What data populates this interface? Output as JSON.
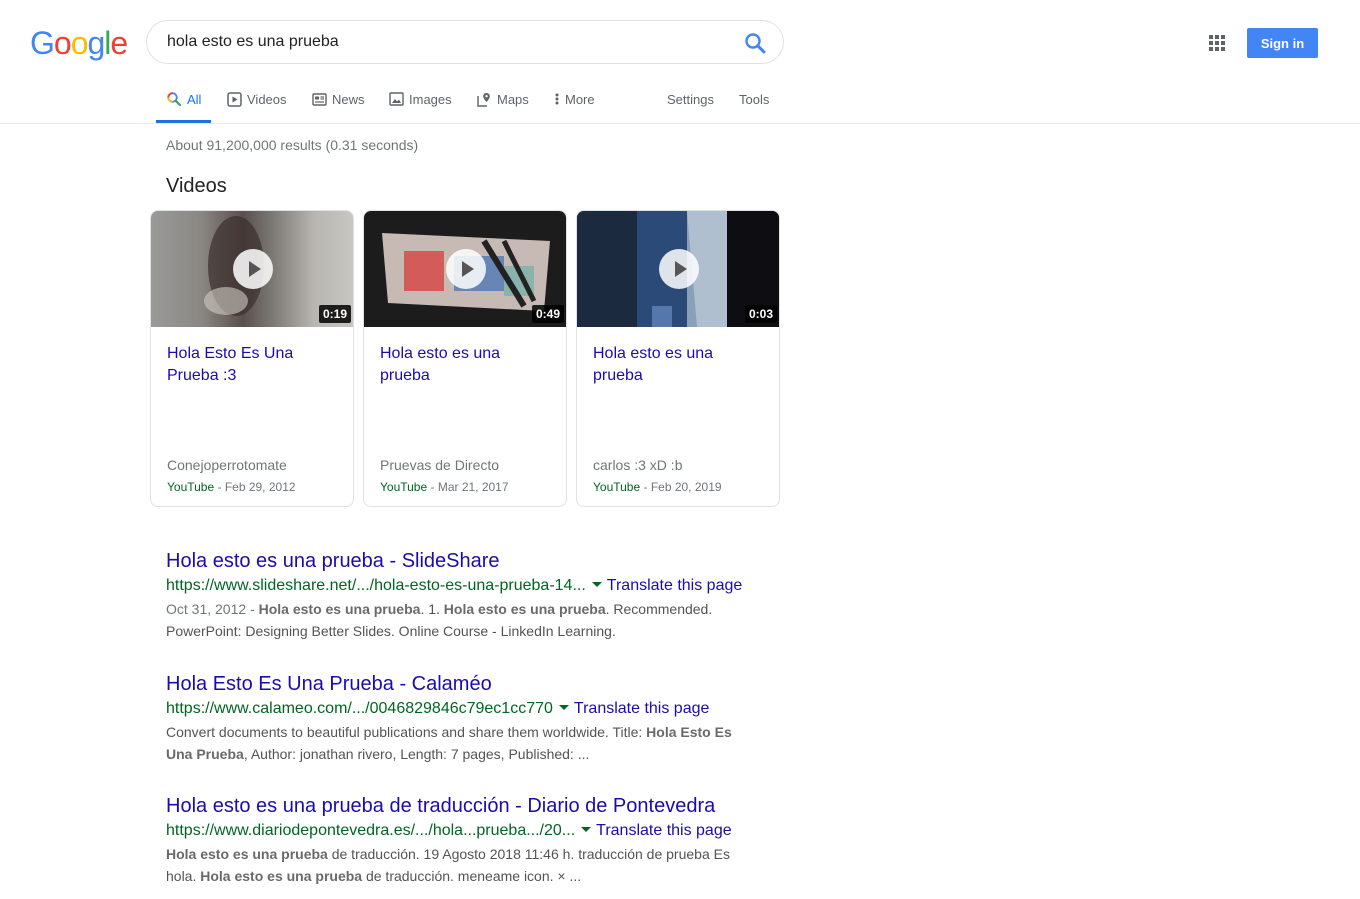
{
  "header": {
    "logo_letters": [
      {
        "ch": "G",
        "color": "#4285f4"
      },
      {
        "ch": "o",
        "color": "#ea4335"
      },
      {
        "ch": "o",
        "color": "#fbbc05"
      },
      {
        "ch": "g",
        "color": "#4285f4"
      },
      {
        "ch": "l",
        "color": "#34a853"
      },
      {
        "ch": "e",
        "color": "#ea4335"
      }
    ],
    "search_query": "hola esto es una prueba",
    "signin_label": "Sign in"
  },
  "tabs": {
    "all": "All",
    "videos": "Videos",
    "news": "News",
    "images": "Images",
    "maps": "Maps",
    "more": "More",
    "settings": "Settings",
    "tools": "Tools"
  },
  "result_stats": "About 91,200,000 results (0.31 seconds)",
  "videos_heading": "Videos",
  "videos": [
    {
      "title": "Hola Esto Es Una Prueba :3",
      "duration": "0:19",
      "channel": "Conejoperrotomate",
      "source": "YouTube",
      "date": " - Feb 29, 2012"
    },
    {
      "title": "Hola esto es una prueba",
      "duration": "0:49",
      "channel": "Pruevas de Directo",
      "source": "YouTube",
      "date": " - Mar 21, 2017"
    },
    {
      "title": "Hola esto es una prueba",
      "duration": "0:03",
      "channel": "carlos :3 xD :b",
      "source": "YouTube",
      "date": " - Feb 20, 2019"
    }
  ],
  "results": [
    {
      "title": "Hola esto es una prueba - SlideShare",
      "url": "https://www.slideshare.net/.../hola-esto-es-una-prueba-14...",
      "translate": "Translate this page",
      "date": "Oct 31, 2012 - ",
      "snippet": [
        {
          "b": true,
          "t": "Hola esto es una prueba"
        },
        {
          "b": false,
          "t": ". 1. "
        },
        {
          "b": true,
          "t": "Hola esto es una prueba"
        },
        {
          "b": false,
          "t": ". Recommended. PowerPoint: Designing Better Slides. Online Course - LinkedIn Learning."
        }
      ]
    },
    {
      "title": "Hola Esto Es Una Prueba - Calaméo",
      "url": "https://www.calameo.com/.../0046829846c79ec1cc770",
      "translate": "Translate this page",
      "date": "",
      "snippet": [
        {
          "b": false,
          "t": "Convert documents to beautiful publications and share them worldwide. Title: "
        },
        {
          "b": true,
          "t": "Hola Esto Es Una Prueba"
        },
        {
          "b": false,
          "t": ", Author: jonathan rivero, Length: 7 pages, Published: ..."
        }
      ]
    },
    {
      "title": "Hola esto es una prueba de traducción - Diario de Pontevedra",
      "url": "https://www.diariodepontevedra.es/.../hola...prueba.../20...",
      "translate": "Translate this page",
      "date": "",
      "snippet": [
        {
          "b": true,
          "t": "Hola esto es una prueba"
        },
        {
          "b": false,
          "t": " de traducción. 19 Agosto 2018 11:46 h. traducción de prueba Es hola. "
        },
        {
          "b": true,
          "t": "Hola esto es una prueba"
        },
        {
          "b": false,
          "t": " de traducción. meneame icon. × ..."
        }
      ]
    }
  ]
}
